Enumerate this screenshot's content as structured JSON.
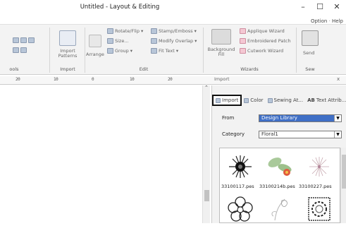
{
  "window": {
    "title": "Untitled - Layout & Editing",
    "minimize": "–",
    "maximize": "☐",
    "close": "✕"
  },
  "menu": {
    "option": "Option",
    "help": "Help"
  },
  "ribbon": {
    "groups": {
      "tools": "ools",
      "import": "Import",
      "edit": "Edit",
      "wizards": "Wizards",
      "sew": "Sew"
    },
    "buttons": {
      "import_patterns": "Import Patterns",
      "arrange": "Arrange",
      "rotate_flip": "Rotate/Flip",
      "size": "Size...",
      "group": "Group",
      "stamp_emboss": "Stamp/Emboss",
      "modify_overlap": "Modify Overlap",
      "fit_text": "Fit Text",
      "background_fill": "Background Fill",
      "applique_wizard": "Applique Wizard",
      "embroidered_patch": "Embroidered Patch",
      "cutwork_wizard": "Cutwork Wizard",
      "send": "Send"
    }
  },
  "ruler": {
    "ticks": [
      "20",
      "10",
      "0",
      "10",
      "20"
    ]
  },
  "panel": {
    "title": "Import",
    "close": "x",
    "tabs": [
      {
        "label": "Import",
        "active": true
      },
      {
        "label": "Color"
      },
      {
        "label": "Sewing At..."
      },
      {
        "label": "Text Attrib..."
      }
    ],
    "from": {
      "label": "From",
      "value": "Design Library"
    },
    "category": {
      "label": "Category",
      "value": "Floral1"
    },
    "thumbnails": [
      {
        "label": "33100117.pes"
      },
      {
        "label": "33100214b.pes"
      },
      {
        "label": "33100227.pes"
      },
      {
        "label": ""
      },
      {
        "label": ""
      },
      {
        "label": ""
      }
    ]
  }
}
